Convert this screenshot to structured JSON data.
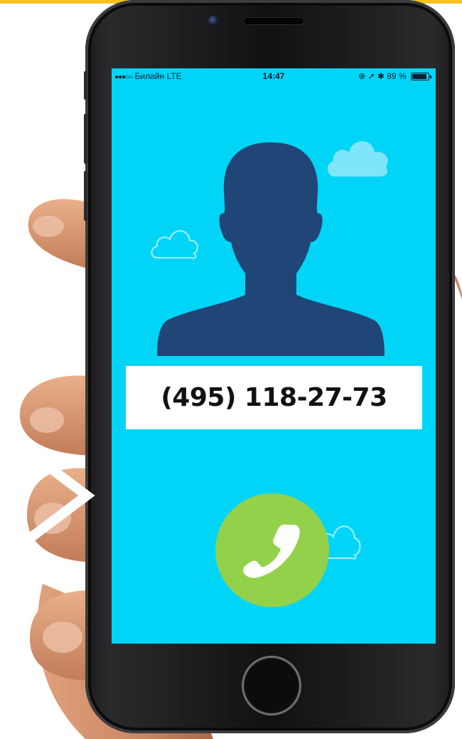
{
  "status_bar": {
    "signal": "●●●○○",
    "carrier": "Билайн",
    "network": "LTE",
    "time": "14:47",
    "indicators": "⊕ ➚ ✱",
    "battery_percent": "89 %",
    "battery_level": 0.89
  },
  "contact": {
    "phone_number": "(495) 118-27-73",
    "avatar_icon": "person-silhouette-icon"
  },
  "call_button": {
    "icon": "phone-handset-icon"
  },
  "colors": {
    "screen_background": "#00d5f8",
    "avatar": "#1f4677",
    "call_button": "#93d14a",
    "accent_strip": "#f7c21c"
  }
}
